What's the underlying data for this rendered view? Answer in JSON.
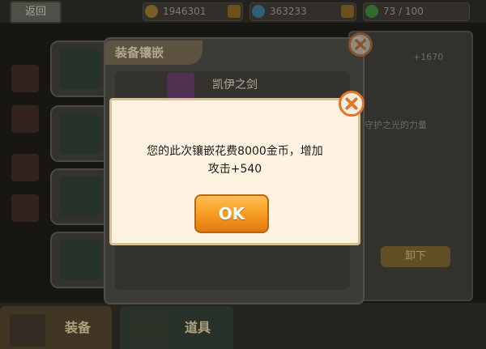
{
  "topbar": {
    "back_label": "返回",
    "gold": "1946301",
    "diamonds": "363233",
    "stamina": "73 / 100"
  },
  "equip_panel": {
    "title": "装备镶嵌",
    "item_name": "凯伊之剑"
  },
  "right_panel": {
    "stat_text": "+1670",
    "desc_text": "守护之光的力量",
    "button_label": "卸下"
  },
  "bottom_tabs": [
    {
      "label": "装备"
    },
    {
      "label": "道具"
    }
  ],
  "dialog": {
    "message_line1": "您的此次镶嵌花费8000金币，增加",
    "message_line2": "攻击+540",
    "ok_label": "OK"
  },
  "colors": {
    "dialog_bg": "#fdf3e0",
    "ok_button": "#f59a20",
    "close_ring": "#e0762a"
  }
}
